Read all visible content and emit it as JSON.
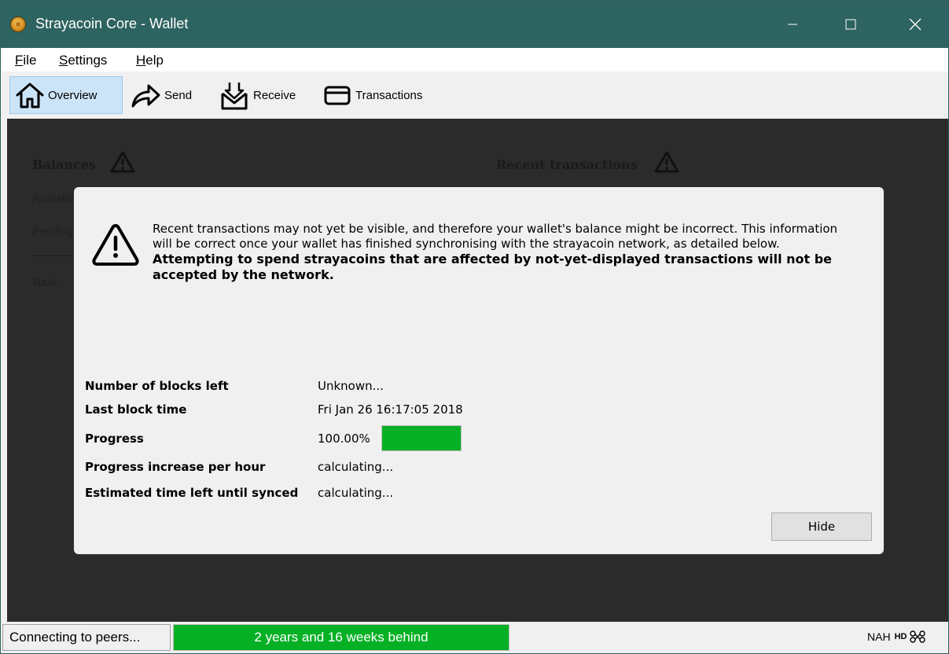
{
  "window": {
    "title": "Strayacoin Core - Wallet"
  },
  "menu": {
    "items": [
      {
        "mnemonic": "F",
        "rest": "ile"
      },
      {
        "mnemonic": "S",
        "rest": "ettings"
      },
      {
        "mnemonic": "H",
        "rest": "elp"
      }
    ]
  },
  "toolbar": {
    "items": [
      {
        "label": "Overview",
        "icon": "home-icon",
        "active": true
      },
      {
        "label": "Send",
        "icon": "send-arrow-icon",
        "active": false
      },
      {
        "label": "Receive",
        "icon": "receive-icon",
        "active": false
      },
      {
        "label": "Transactions",
        "icon": "transactions-icon",
        "active": false
      }
    ]
  },
  "overview": {
    "balances_heading": "Balances",
    "recent_heading": "Recent transactions",
    "available_label": "Available:",
    "pending_label": "Pending:",
    "total_label": "Total:"
  },
  "modal": {
    "message": "Recent transactions may not yet be visible, and therefore your wallet's balance might be incorrect. This information will be correct once your wallet has finished synchronising with the strayacoin network, as detailed below.",
    "warning": "Attempting to spend strayacoins that are affected by not-yet-displayed transactions will not be accepted by the network.",
    "rows": [
      {
        "label": "Number of blocks left",
        "value": "Unknown..."
      },
      {
        "label": "Last block time",
        "value": "Fri Jan 26 16:17:05 2018"
      },
      {
        "label": "Progress",
        "value": "100.00%"
      },
      {
        "label": "Progress increase per hour",
        "value": "calculating..."
      },
      {
        "label": "Estimated time left until synced",
        "value": "calculating..."
      }
    ],
    "progress_percent": 100,
    "hide_button": "Hide"
  },
  "status": {
    "text": "Connecting to peers...",
    "progress_text": "2 years and 16 weeks behind",
    "progress_percent": 100,
    "unit": "NAH",
    "hd_label": "HD",
    "network_icon": "network-activity-icon"
  },
  "colors": {
    "titlebar": "#2d6360",
    "progress_green": "#06b025",
    "main_background": "#2b2b2b"
  }
}
